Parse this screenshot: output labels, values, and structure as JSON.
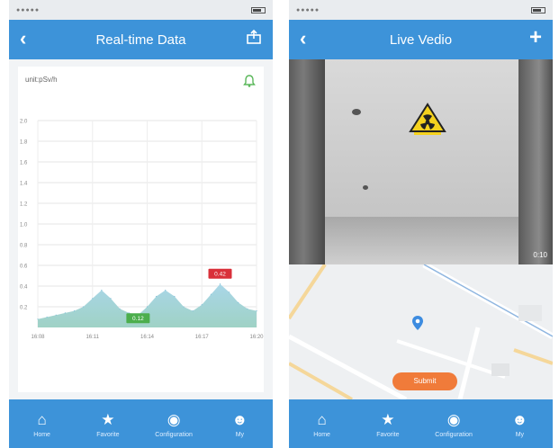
{
  "left_screen": {
    "status_bar": {
      "signal": "●●●●● ",
      "carrier": "",
      "time": ""
    },
    "header": {
      "title": "Real-time Data",
      "back_icon": "back-icon",
      "right_icon": "export-icon"
    },
    "card": {
      "unit_label": "unit:pSv/h",
      "bell_icon": "bell-icon",
      "bell_color": "#5cb85c"
    },
    "tabbar": [
      {
        "label": "Home",
        "icon": "home-icon"
      },
      {
        "label": "Favorite",
        "icon": "star-icon"
      },
      {
        "label": "Configuration",
        "icon": "eye-icon"
      },
      {
        "label": "My",
        "icon": "user-icon"
      }
    ]
  },
  "right_screen": {
    "status_bar": {
      "signal": "●●●●● ",
      "carrier": "",
      "time": ""
    },
    "header": {
      "title": "Live Vedio",
      "back_icon": "back-icon",
      "right_icon": "plus-icon"
    },
    "video": {
      "timer": "0:10"
    },
    "map": {
      "labels": [],
      "submit_label": "Submit"
    },
    "tabbar": [
      {
        "label": "Home",
        "icon": "home-icon"
      },
      {
        "label": "Favorite",
        "icon": "star-icon"
      },
      {
        "label": "Configuration",
        "icon": "eye-icon"
      },
      {
        "label": "My",
        "icon": "user-icon"
      }
    ]
  },
  "colors": {
    "accent": "#3d93d9",
    "area_fill": "#a9d6e8",
    "area_fill_low": "#9fd2c5",
    "min_badge": "#4cae4c",
    "max_badge": "#d9303a",
    "submit": "#f07b3a"
  },
  "chart_data": {
    "type": "area",
    "title": "",
    "xlabel": "",
    "ylabel": "unit:pSv/h",
    "x_ticks": [
      "16:08",
      "16:11",
      "16:14",
      "16:17",
      "16:20"
    ],
    "y_ticks": [
      "0.2",
      "0.4",
      "0.6",
      "0.8",
      "1.0",
      "1.2",
      "1.4",
      "1.6",
      "1.8",
      "2.0"
    ],
    "ylim": [
      0,
      2.0
    ],
    "grid": true,
    "series": [
      {
        "x": [
          0,
          0.5,
          1,
          1.5,
          2,
          2.5,
          3,
          3.5,
          4,
          4.5,
          5,
          5.5,
          6,
          6.5,
          7,
          7.5,
          8,
          8.5,
          9,
          9.5,
          10,
          10.5,
          11,
          11.5,
          12
        ],
        "values": [
          0.08,
          0.1,
          0.12,
          0.14,
          0.16,
          0.2,
          0.28,
          0.36,
          0.28,
          0.18,
          0.14,
          0.12,
          0.2,
          0.3,
          0.36,
          0.3,
          0.2,
          0.16,
          0.22,
          0.32,
          0.42,
          0.34,
          0.24,
          0.18,
          0.16
        ]
      }
    ],
    "markers": [
      {
        "kind": "min",
        "x": 5.5,
        "value": 0.12,
        "label": "0.12"
      },
      {
        "kind": "max",
        "x": 10,
        "value": 0.42,
        "label": "0.42"
      }
    ]
  }
}
